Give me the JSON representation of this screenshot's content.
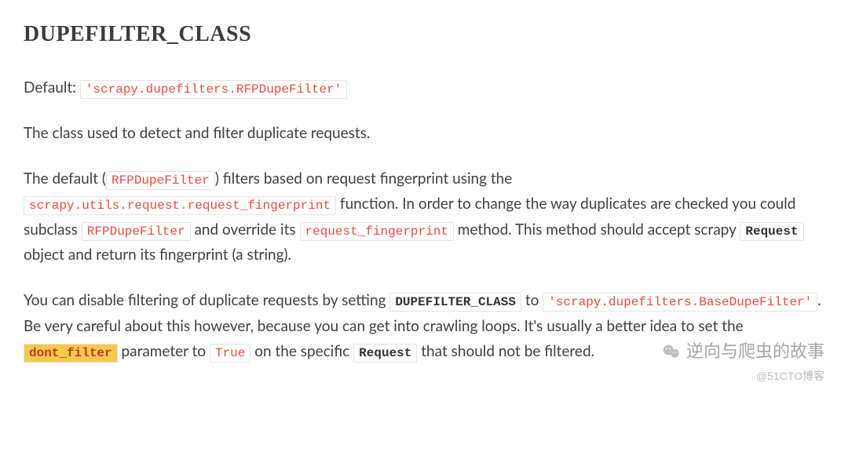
{
  "heading": "DUPEFILTER_CLASS",
  "p1": {
    "prefix": "Default: ",
    "code1": "'scrapy.dupefilters.RFPDupeFilter'"
  },
  "p2": {
    "text": "The class used to detect and filter duplicate requests."
  },
  "p3": {
    "t1": "The default (",
    "c1": "RFPDupeFilter",
    "t2": ") filters based on request fingerprint using the ",
    "c2": "scrapy.utils.request.request_fingerprint",
    "t3": " function. In order to change the way duplicates are checked you could subclass ",
    "c3": "RFPDupeFilter",
    "t4": " and override its ",
    "c4": "request_fingerprint",
    "t5": " method. This method should accept scrapy ",
    "c5": "Request",
    "t6": " object and return its fingerprint (a string)."
  },
  "p4": {
    "t1": "You can disable filtering of duplicate requests by setting ",
    "c1": "DUPEFILTER_CLASS",
    "t2": " to ",
    "c2": "'scrapy.dupefilters.BaseDupeFilter'",
    "t3": ". Be very careful about this however, because you can get into crawling loops. It's usually a better idea to set the ",
    "c3": "dont_filter",
    "t4": " parameter to ",
    "c4": "True",
    "t5": " on the specific ",
    "c5": "Request",
    "t6": " that should not be filtered."
  },
  "watermark": {
    "main": "逆向与爬虫的故事",
    "footer": "@51CTO博客"
  }
}
